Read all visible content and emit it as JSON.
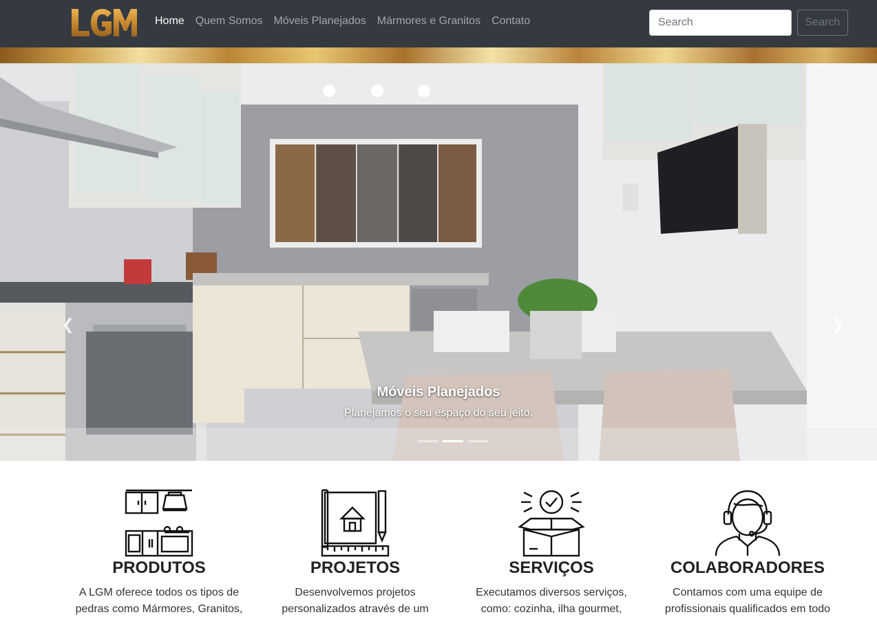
{
  "brand": {
    "logo_text": "LGM"
  },
  "nav": {
    "items": [
      {
        "label": "Home",
        "active": true
      },
      {
        "label": "Quem Somos",
        "active": false
      },
      {
        "label": "Móveis Planejados",
        "active": false
      },
      {
        "label": "Mármores e Granitos",
        "active": false
      },
      {
        "label": "Contato",
        "active": false
      }
    ]
  },
  "search": {
    "placeholder": "Search",
    "button_label": "Search"
  },
  "carousel": {
    "caption_title": "Móveis Planejados",
    "caption_text": "Planejamos o seu espaço do seu jeito.",
    "prev_icon": "chevron-left-icon",
    "next_icon": "chevron-right-icon",
    "slide_count": 3,
    "active_index": 1
  },
  "features": [
    {
      "title": "PRODUTOS",
      "text_line1": "A LGM oferece todos os tipos de",
      "text_line2": "pedras como Mármores, Granitos,",
      "icon": "kitchen-cabinets-icon"
    },
    {
      "title": "PROJETOS",
      "text_line1": "Desenvolvemos projetos",
      "text_line2": "personalizados através de um",
      "icon": "blueprint-house-icon"
    },
    {
      "title": "SERVIÇOS",
      "text_line1": "Executamos diversos serviços,",
      "text_line2": "como: cozinha, ilha gourmet,",
      "icon": "box-check-icon"
    },
    {
      "title": "COLABORADORES",
      "text_line1": "Contamos com uma equipe de",
      "text_line2": "profissionais qualificados em todo",
      "icon": "headset-support-icon"
    }
  ],
  "colors": {
    "navbar": "#343a40",
    "gold": "#c79a48"
  }
}
